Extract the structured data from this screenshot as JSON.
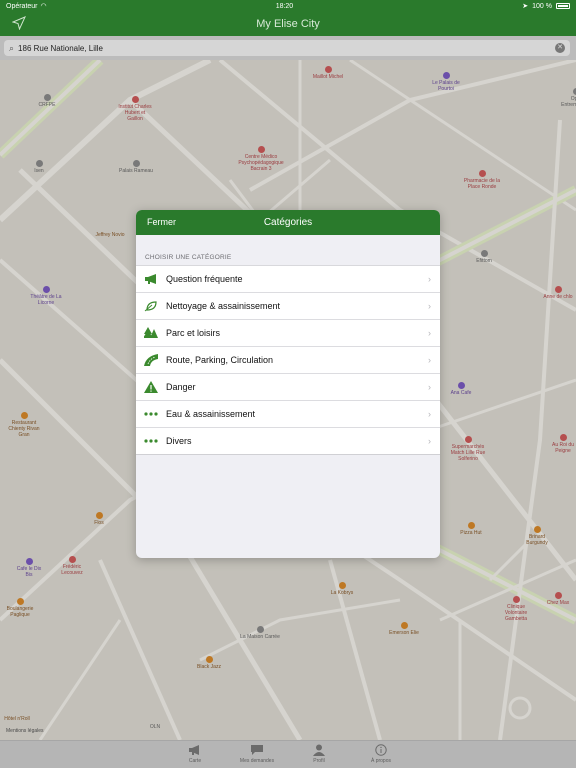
{
  "status": {
    "carrier": "Opérateur",
    "time": "18:20",
    "battery": "100 %"
  },
  "app": {
    "title": "My Elise City"
  },
  "search": {
    "value": "186 Rue Nationale, Lille"
  },
  "map": {
    "legal": "Mentions légales",
    "pois": [
      {
        "name": "CRFPE",
        "style": "grey"
      },
      {
        "name": "Institut Charles Hubert et Gaillon",
        "style": "red"
      },
      {
        "name": "Maillot Michel",
        "style": "red"
      },
      {
        "name": "Le Palais de Pourtoi",
        "style": "purple"
      },
      {
        "name": "Opio Entremondes",
        "style": "grey"
      },
      {
        "name": "Isen",
        "style": "grey"
      },
      {
        "name": "Palais Rameau",
        "style": "grey"
      },
      {
        "name": "Centre Médico Psychopédagogique Bacrain 3",
        "style": "red"
      },
      {
        "name": "Pharmacie de la Place Ronde",
        "style": "red"
      },
      {
        "name": "Jeffrey Novio",
        "style": "brown"
      },
      {
        "name": "Efittom",
        "style": "grey"
      },
      {
        "name": "Théâtre de La Licorne",
        "style": "purple"
      },
      {
        "name": "Anne de chlo",
        "style": "red"
      },
      {
        "name": "Restaurant Chienty Rivan Gran",
        "style": "brown"
      },
      {
        "name": "Ana Cafe",
        "style": "purple"
      },
      {
        "name": "Supermarchés Match Lille Rue Solferino",
        "style": "red"
      },
      {
        "name": "Au Roi du Peigne",
        "style": "red"
      },
      {
        "name": "Flos",
        "style": "brown"
      },
      {
        "name": "Pizza Hut",
        "style": "brown"
      },
      {
        "name": "Brinard Burgundy",
        "style": "brown"
      },
      {
        "name": "Cafe le Dix Bis",
        "style": "purple"
      },
      {
        "name": "Frédéric Lecouvez",
        "style": "red"
      },
      {
        "name": "La Kobrys",
        "style": "brown"
      },
      {
        "name": "Boulangerie Paglique",
        "style": "brown"
      },
      {
        "name": "Clinique Volontaire Gambetta",
        "style": "red"
      },
      {
        "name": "Chez Max",
        "style": "red"
      },
      {
        "name": "Emerson Elie",
        "style": "brown"
      },
      {
        "name": "La Maison Carrée",
        "style": "grey"
      },
      {
        "name": "Black Jazz",
        "style": "brown"
      },
      {
        "name": "Hôtel n'Roll",
        "style": "brown"
      },
      {
        "name": "OLN",
        "style": "grey"
      }
    ]
  },
  "modal": {
    "close_label": "Fermer",
    "title": "Catégories",
    "section_label": "CHOISIR UNE CATÉGORIE",
    "items": [
      {
        "label": "Question fréquente",
        "icon": "megaphone-icon"
      },
      {
        "label": "Nettoyage & assainissement",
        "icon": "leaf-icon"
      },
      {
        "label": "Parc et loisirs",
        "icon": "trees-icon"
      },
      {
        "label": "Route, Parking, Circulation",
        "icon": "road-icon"
      },
      {
        "label": "Danger",
        "icon": "warning-icon"
      },
      {
        "label": "Eau & assainissement",
        "icon": "ellipsis-icon"
      },
      {
        "label": "Divers",
        "icon": "ellipsis-icon"
      }
    ]
  },
  "tabs": [
    {
      "label": "Carte",
      "icon": "megaphone-icon"
    },
    {
      "label": "Mes demandes",
      "icon": "chat-icon"
    },
    {
      "label": "Profil",
      "icon": "person-icon"
    },
    {
      "label": "À propos",
      "icon": "info-icon"
    }
  ],
  "colors": {
    "brand": "#2a7a2c",
    "icon_green": "#3b8a2e"
  }
}
